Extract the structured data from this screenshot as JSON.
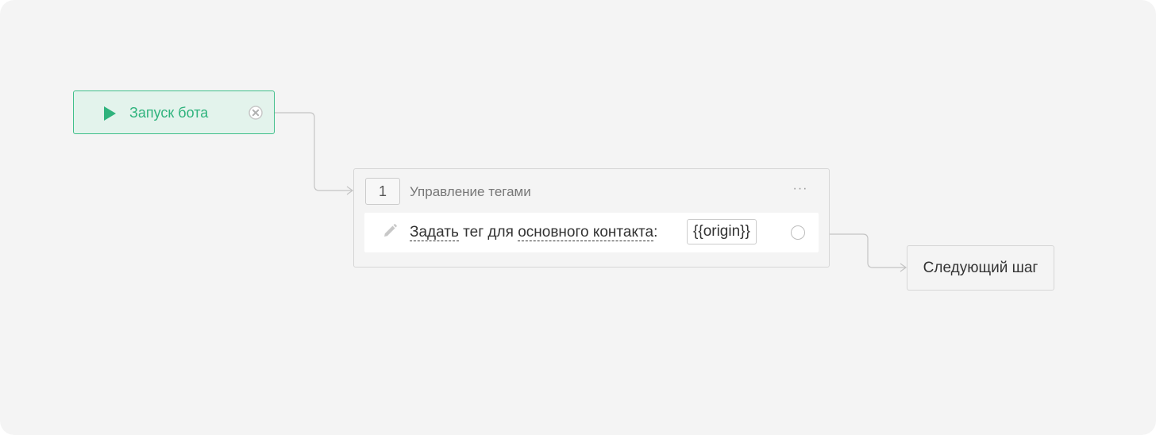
{
  "start_node": {
    "label": "Запуск бота",
    "icon": "play-icon",
    "remove_icon": "close-circle-icon",
    "accent_color": "#2fb37d"
  },
  "action_block": {
    "step_number": "1",
    "title": "Управление тегами",
    "menu_label": "···",
    "row": {
      "icon": "pencil-icon",
      "action_word": "Задать",
      "middle_text": " тег для ",
      "target_text": "основного контакта",
      "colon": ":",
      "variable": "{{origin}}"
    }
  },
  "next_step": {
    "label": "Следующий шаг"
  }
}
